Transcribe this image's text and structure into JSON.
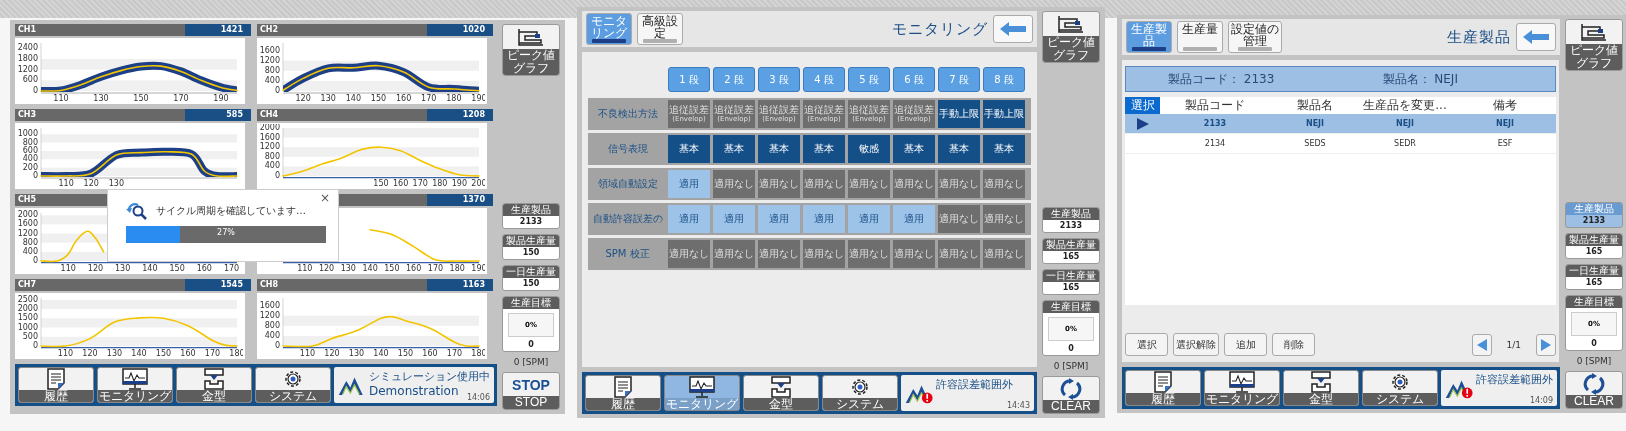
{
  "screens": [
    {
      "kind": "charts",
      "charts": [
        {
          "label": "CH1",
          "value": "1421",
          "envelope": true,
          "chart_data": {
            "type": "line",
            "x": [
              100,
              110,
              120,
              130,
              140,
              150,
              160,
              170,
              180,
              190,
              198
            ],
            "xlim": [
              100,
              198
            ],
            "ylim": [
              0,
              2700
            ],
            "xticks": [
              110,
              130,
              150,
              170,
              190
            ],
            "yticks": [
              0,
              600,
              1200,
              1800,
              2400
            ],
            "series": [
              {
                "color": "#f2c500",
                "values": [
                  0,
                  30,
                  350,
                  800,
                  1150,
                  1380,
                  1400,
                  1100,
                  600,
                  200,
                  30
                ]
              }
            ]
          }
        },
        {
          "label": "CH2",
          "value": "1020",
          "envelope": true,
          "chart_data": {
            "type": "line",
            "x": [
              112,
              120,
              130,
              140,
              150,
              160,
              170,
              180,
              190
            ],
            "xlim": [
              112,
              190
            ],
            "ylim": [
              0,
              1900
            ],
            "xticks": [
              120,
              130,
              140,
              150,
              160,
              170,
              180,
              190
            ],
            "yticks": [
              0,
              400,
              800,
              1200,
              1600
            ],
            "series": [
              {
                "color": "#f2c500",
                "values": [
                  30,
                  500,
                  900,
                  920,
                  1000,
                  750,
                  150,
                  80,
                  10
                ]
              }
            ]
          }
        },
        {
          "label": "CH3",
          "value": "585",
          "envelope": true,
          "chart_data": {
            "type": "line",
            "x": [
              100,
              110,
              120,
              130,
              140,
              150,
              160,
              165,
              170,
              178
            ],
            "xlim": [
              100,
              178
            ],
            "ylim": [
              0,
              1150
            ],
            "xticks": [
              110,
              120,
              130
            ],
            "yticks": [
              0,
              200,
              400,
              600,
              800,
              1000
            ],
            "series": [
              {
                "color": "#f2c500",
                "values": [
                  0,
                  0,
                  60,
                  500,
                  560,
                  580,
                  520,
                  120,
                  0,
                  0
                ]
              }
            ]
          }
        },
        {
          "label": "CH4",
          "value": "1208",
          "envelope": false,
          "chart_data": {
            "type": "line",
            "x": [
              100,
              110,
              120,
              130,
              140,
              150,
              160,
              170,
              180,
              190,
              200
            ],
            "xlim": [
              100,
              200
            ],
            "ylim": [
              0,
              2000
            ],
            "xticks": [
              150,
              160,
              170,
              180,
              190,
              200
            ],
            "yticks": [
              0,
              400,
              800,
              1200,
              1600,
              2000
            ],
            "series": [
              {
                "color": "#f2c500",
                "values": [
                  0,
                  200,
                  500,
                  750,
                  1100,
                  1200,
                  1050,
                  650,
                  300,
                  50,
                  0
                ]
              }
            ]
          }
        },
        {
          "label": "CH5",
          "envelope": false,
          "chart_data": {
            "type": "line",
            "x": [
              100,
              106,
              110,
              113,
              117,
              120,
              123
            ],
            "xlim": [
              100,
              172
            ],
            "ylim": [
              0,
              2100
            ],
            "xticks": [
              110,
              120,
              130,
              140,
              150,
              160,
              170
            ],
            "yticks": [
              0,
              400,
              800,
              1200,
              1600,
              2000
            ],
            "series": [
              {
                "color": "#f2c500",
                "values": [
                  0,
                  0,
                  300,
                  900,
                  1300,
                  1000,
                  400
                ]
              }
            ]
          }
        },
        {
          "value": "1370",
          "envelope": false,
          "chart_data": {
            "type": "line",
            "x": [
              140,
              150,
              160,
              170,
              180,
              190
            ],
            "xlim": [
              100,
              190
            ],
            "ylim": [
              0,
              2000
            ],
            "xticks": [
              110,
              120,
              130,
              140,
              150,
              160,
              170,
              180,
              190
            ],
            "series": [
              {
                "color": "#f2c500",
                "values": [
                  1300,
                  1100,
                  600,
                  50,
                  0,
                  0
                ]
              }
            ]
          }
        },
        {
          "label": "CH7",
          "value": "1545",
          "envelope": false,
          "chart_data": {
            "type": "line",
            "x": [
              100,
              110,
              120,
              130,
              140,
              150,
              160,
              170,
              175,
              180
            ],
            "xlim": [
              100,
              180
            ],
            "ylim": [
              0,
              2600
            ],
            "xticks": [
              110,
              120,
              130,
              140,
              150,
              160,
              170,
              180
            ],
            "yticks": [
              0,
              500,
              1000,
              1500,
              2000,
              2500
            ],
            "series": [
              {
                "color": "#f2c500",
                "values": [
                  0,
                  0,
                  400,
                  1300,
                  1520,
                  1500,
                  1100,
                  300,
                  50,
                  0
                ]
              }
            ]
          }
        },
        {
          "label": "CH8",
          "value": "1163",
          "envelope": false,
          "chart_data": {
            "type": "line",
            "x": [
              100,
              112,
              120,
              130,
              140,
              145,
              150,
              160,
              170,
              175,
              180
            ],
            "xlim": [
              100,
              180
            ],
            "ylim": [
              0,
              1900
            ],
            "xticks": [
              110,
              120,
              130,
              140,
              150,
              160,
              170,
              180
            ],
            "yticks": [
              0,
              400,
              800,
              1200,
              1600
            ],
            "series": [
              {
                "color": "#f2c500",
                "values": [
                  0,
                  0,
                  300,
                  600,
                  1100,
                  1150,
                  1000,
                  700,
                  150,
                  0,
                  0
                ]
              }
            ]
          }
        }
      ],
      "dialog": {
        "close": "×",
        "message": "サイクル周期を確認しています…",
        "progress": {
          "level": 0.27,
          "label": "27%"
        }
      },
      "nav": [
        {
          "kind": "history",
          "label": "履歴",
          "selected": false
        },
        {
          "kind": "monitor",
          "label": "モニタリング",
          "selected": false
        },
        {
          "kind": "die",
          "label": "金型",
          "selected": false
        },
        {
          "kind": "system",
          "label": "システム",
          "selected": false
        }
      ],
      "status": {
        "alert": false,
        "title": "シミュレーション使用中",
        "subtitle": "Demonstration",
        "time": "14:06"
      },
      "side": {
        "peak_button": "ピーク値グラフ",
        "stats": [
          {
            "label": "生産製品",
            "value": "2133",
            "selected": false
          },
          {
            "label": "製品生産量",
            "value": "150",
            "selected": false
          },
          {
            "label": "一日生産量",
            "value": "150",
            "selected": false
          }
        ],
        "target": {
          "label": "生産目標",
          "percent": "0%",
          "count": "0"
        },
        "spm": "0 [SPM]",
        "action": {
          "kind": "stop",
          "text": "STOP",
          "label": "STOP"
        }
      }
    },
    {
      "kind": "monitoring",
      "tabs": [
        {
          "label": "モニタリング",
          "selected": true
        },
        {
          "label": "高級設定",
          "selected": false
        }
      ],
      "title": "モニタリング",
      "stages": [
        "1 段",
        "2 段",
        "3 段",
        "4 段",
        "5 段",
        "6 段",
        "7 段",
        "8 段"
      ],
      "rows": [
        {
          "label": "不良検出方法",
          "cells": [
            {
              "kind": "gray",
              "text": "追従誤差",
              "sub": "(Envelop)"
            },
            {
              "kind": "gray",
              "text": "追従誤差",
              "sub": "(Envelop)"
            },
            {
              "kind": "gray",
              "text": "追従誤差",
              "sub": "(Envelop)"
            },
            {
              "kind": "gray",
              "text": "追従誤差",
              "sub": "(Envelop)"
            },
            {
              "kind": "gray",
              "text": "追従誤差",
              "sub": "(Envelop)"
            },
            {
              "kind": "gray",
              "text": "追従誤差",
              "sub": "(Envelop)"
            },
            {
              "kind": "dark",
              "text": "手動上限"
            },
            {
              "kind": "dark",
              "text": "手動上限"
            }
          ]
        },
        {
          "label": "信号表現",
          "cells": [
            {
              "kind": "dark",
              "text": "基本"
            },
            {
              "kind": "dark",
              "text": "基本"
            },
            {
              "kind": "dark",
              "text": "基本"
            },
            {
              "kind": "dark",
              "text": "基本"
            },
            {
              "kind": "dark",
              "text": "敏感"
            },
            {
              "kind": "dark",
              "text": "基本"
            },
            {
              "kind": "dark",
              "text": "基本"
            },
            {
              "kind": "dark",
              "text": "基本"
            }
          ]
        },
        {
          "label": "領域自動設定",
          "cells": [
            {
              "kind": "light",
              "text": "適用"
            },
            {
              "kind": "gray",
              "text": "適用なし"
            },
            {
              "kind": "gray",
              "text": "適用なし"
            },
            {
              "kind": "gray",
              "text": "適用なし"
            },
            {
              "kind": "gray",
              "text": "適用なし"
            },
            {
              "kind": "gray",
              "text": "適用なし"
            },
            {
              "kind": "gray",
              "text": "適用なし"
            },
            {
              "kind": "gray",
              "text": "適用なし"
            }
          ]
        },
        {
          "label": "自動許容誤差の",
          "cells": [
            {
              "kind": "light",
              "text": "適用"
            },
            {
              "kind": "light",
              "text": "適用"
            },
            {
              "kind": "light",
              "text": "適用"
            },
            {
              "kind": "light",
              "text": "適用"
            },
            {
              "kind": "light",
              "text": "適用"
            },
            {
              "kind": "light",
              "text": "適用"
            },
            {
              "kind": "gray",
              "text": "適用なし"
            },
            {
              "kind": "gray",
              "text": "適用なし"
            }
          ]
        },
        {
          "label": "SPM 校正",
          "cells": [
            {
              "kind": "gray",
              "text": "適用なし"
            },
            {
              "kind": "gray",
              "text": "適用なし"
            },
            {
              "kind": "gray",
              "text": "適用なし"
            },
            {
              "kind": "gray",
              "text": "適用なし"
            },
            {
              "kind": "gray",
              "text": "適用なし"
            },
            {
              "kind": "gray",
              "text": "適用なし"
            },
            {
              "kind": "gray",
              "text": "適用なし"
            },
            {
              "kind": "gray",
              "text": "適用なし"
            }
          ]
        }
      ],
      "nav": [
        {
          "kind": "history",
          "label": "履歴",
          "selected": false
        },
        {
          "kind": "monitor",
          "label": "モニタリング",
          "selected": true
        },
        {
          "kind": "die",
          "label": "金型",
          "selected": false
        },
        {
          "kind": "system",
          "label": "システム",
          "selected": false
        }
      ],
      "status": {
        "alert": true,
        "title": "許容誤差範囲外",
        "time": "14:43"
      },
      "side": {
        "peak_button": "ピーク値グラフ",
        "stats": [
          {
            "label": "生産製品",
            "value": "2133",
            "selected": false
          },
          {
            "label": "製品生産量",
            "value": "165",
            "selected": false
          },
          {
            "label": "一日生産量",
            "value": "165",
            "selected": false
          }
        ],
        "target": {
          "label": "生産目標",
          "percent": "0%",
          "count": "0"
        },
        "spm": "0 [SPM]",
        "action": {
          "kind": "clear",
          "label": "CLEAR"
        }
      }
    },
    {
      "kind": "product",
      "tabs": [
        {
          "label": "生産製品",
          "selected": true
        },
        {
          "label": "生産量",
          "selected": false
        },
        {
          "label": "設定値の管理",
          "selected": false
        }
      ],
      "title": "生産製品",
      "info": [
        "製品コード： 2133",
        "製品名： NEJI"
      ],
      "table": {
        "columns": [
          "選択",
          "製品コード",
          "製品名",
          "生産品を変更...",
          "備考"
        ],
        "rows": [
          {
            "selected": true,
            "cells": [
              "",
              "2133",
              "NEJI",
              "NEJI",
              "NEJI"
            ]
          },
          {
            "selected": false,
            "cells": [
              "",
              "2134",
              "SEDS",
              "SEDR",
              "ESF"
            ]
          }
        ]
      },
      "buttons": [
        "選択",
        "選択解除",
        "追加",
        "削除"
      ],
      "pager": "1/1",
      "nav": [
        {
          "kind": "history",
          "label": "履歴",
          "selected": false
        },
        {
          "kind": "monitor",
          "label": "モニタリング",
          "selected": false
        },
        {
          "kind": "die",
          "label": "金型",
          "selected": false
        },
        {
          "kind": "system",
          "label": "システム",
          "selected": false
        }
      ],
      "status": {
        "alert": true,
        "title": "許容誤差範囲外",
        "time": "14:09"
      },
      "side": {
        "peak_button": "ピーク値グラフ",
        "stats": [
          {
            "label": "生産製品",
            "value": "2133",
            "selected": true
          },
          {
            "label": "製品生産量",
            "value": "165",
            "selected": false
          },
          {
            "label": "一日生産量",
            "value": "165",
            "selected": false
          }
        ],
        "target": {
          "label": "生産目標",
          "percent": "0%",
          "count": "0"
        },
        "spm": "0 [SPM]",
        "action": {
          "kind": "clear",
          "label": "CLEAR"
        }
      }
    }
  ]
}
